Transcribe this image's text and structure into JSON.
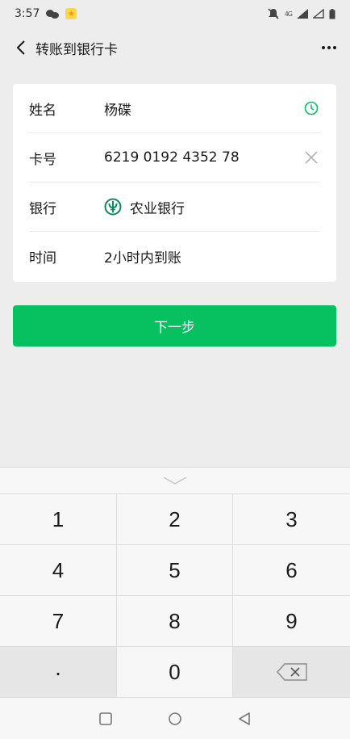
{
  "status_bar": {
    "time": "3:57",
    "signal_text": "4G"
  },
  "nav": {
    "title": "转账到银行卡"
  },
  "form": {
    "rows": [
      {
        "label": "姓名",
        "value": "杨碟"
      },
      {
        "label": "卡号",
        "value": "6219 0192 4352 78"
      },
      {
        "label": "银行",
        "value": "农业银行"
      },
      {
        "label": "时间",
        "value": "2小时内到账"
      }
    ]
  },
  "next_button": {
    "label": "下一步"
  },
  "keyboard": {
    "keys": [
      "1",
      "2",
      "3",
      "4",
      "5",
      "6",
      "7",
      "8",
      "9",
      ".",
      "0"
    ]
  },
  "colors": {
    "accent": "#07c160",
    "bank_logo": "#0a8a5f"
  },
  "icons": {
    "name_row": "clock-icon",
    "card_row": "clear-icon",
    "bank_row": "abc-bank-logo-icon",
    "keyboard_delete": "backspace-icon"
  }
}
